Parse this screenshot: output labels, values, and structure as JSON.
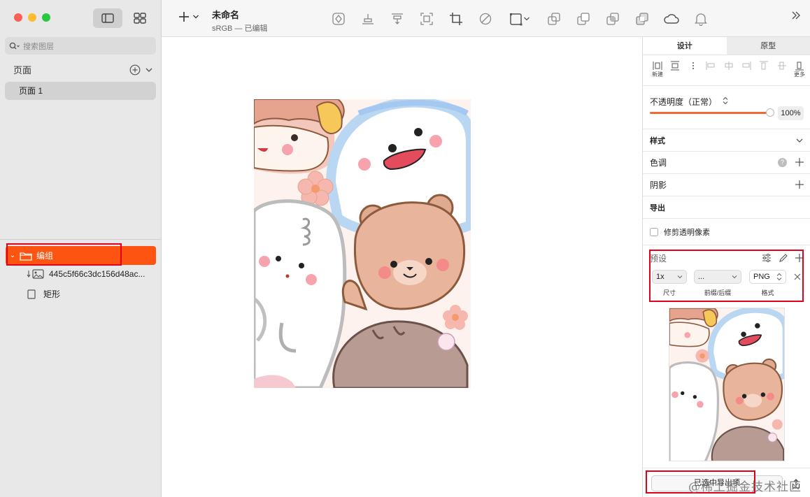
{
  "sidebar": {
    "search_placeholder": "搜索图层",
    "pages_title": "页面",
    "pages": [
      "页面 1"
    ],
    "layers": [
      {
        "name": "编组",
        "type": "group"
      },
      {
        "name": "445c5f66c3dc156d48ac...",
        "type": "image"
      },
      {
        "name": "矩形",
        "type": "rectangle"
      }
    ]
  },
  "toolbar": {
    "doc_title": "未命名",
    "doc_subtitle": "sRGB — 已编辑",
    "icons": [
      "add-icon",
      "symbol-icon",
      "align-bottom-icon",
      "align-top-icon",
      "frame-icon",
      "crop-icon",
      "mask-icon",
      "scale-icon",
      "union-icon",
      "subtract-icon",
      "intersect-icon",
      "difference-icon",
      "cloud-icon",
      "bell-icon",
      "expand-icon"
    ]
  },
  "inspector": {
    "tabs": [
      "设计",
      "原型"
    ],
    "active_tab": "设计",
    "align_labels": [
      "新建",
      "",
      "",
      "",
      "更多"
    ],
    "opacity_label": "不透明度（正常）",
    "opacity_value": "100%",
    "opacity_level": 1.0,
    "sections": {
      "style": "样式",
      "tint": "色调",
      "shadow": "阴影",
      "export": "导出"
    },
    "trim_transparent": "修剪透明像素",
    "preset_label": "预设",
    "export_size": "1x",
    "export_prefix": "...",
    "export_format": "PNG",
    "size_caption": "尺寸",
    "prefix_caption": "前缀/后缀",
    "format_caption": "格式",
    "export_selected_button": "已选中导出项"
  },
  "watermark": "@稀土掘金技术社区",
  "colors": {
    "accent": "#fe5412",
    "highlight_box": "#e3001b",
    "slider": "#f06a35"
  }
}
